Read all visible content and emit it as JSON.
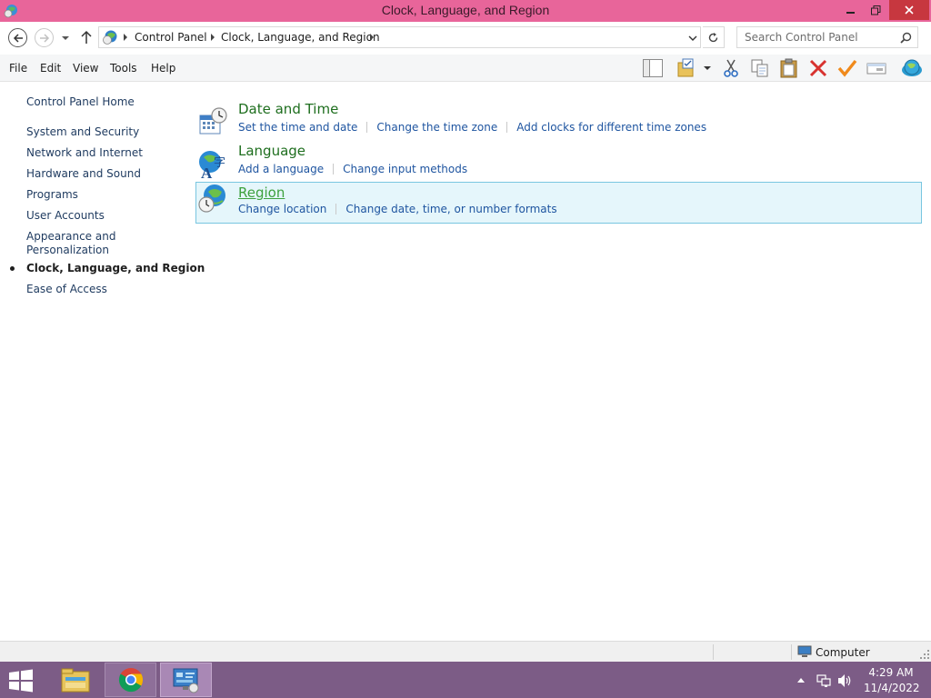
{
  "window": {
    "title": "Clock, Language, and Region"
  },
  "address": {
    "crumbs": [
      "Control Panel",
      "Clock, Language, and Region"
    ],
    "search_placeholder": "Search Control Panel"
  },
  "menu": [
    "File",
    "Edit",
    "View",
    "Tools",
    "Help"
  ],
  "toolbar_icons": [
    "layout-pane-icon",
    "folder-options-icon",
    "cut-icon",
    "copy-icon",
    "paste-icon",
    "delete-icon",
    "checkmark-icon",
    "properties-icon",
    "globe-icon"
  ],
  "sidebar": {
    "home": "Control Panel Home",
    "items": [
      "System and Security",
      "Network and Internet",
      "Hardware and Sound",
      "Programs",
      "User Accounts",
      "Appearance and Personalization",
      "Clock, Language, and Region",
      "Ease of Access"
    ],
    "current_index": 6
  },
  "categories": [
    {
      "title": "Date and Time",
      "icon": "date-time-icon",
      "links": [
        "Set the time and date",
        "Change the time zone",
        "Add clocks for different time zones"
      ]
    },
    {
      "title": "Language",
      "icon": "language-icon",
      "links": [
        "Add a language",
        "Change input methods"
      ]
    },
    {
      "title": "Region",
      "icon": "region-globe-icon",
      "selected": true,
      "links": [
        "Change location",
        "Change date, time, or number formats"
      ]
    }
  ],
  "status": {
    "text": "Computer"
  },
  "taskbar": {
    "apps": [
      "file-explorer-icon",
      "chrome-icon",
      "control-panel-icon"
    ],
    "time": "4:29 AM",
    "date": "11/4/2022"
  },
  "colors": {
    "titlebar": "#e8659a",
    "taskbar": "#7c5c86",
    "link": "#1f55a0",
    "category_title": "#1e6e1e",
    "selection": "#e5f6fb"
  }
}
